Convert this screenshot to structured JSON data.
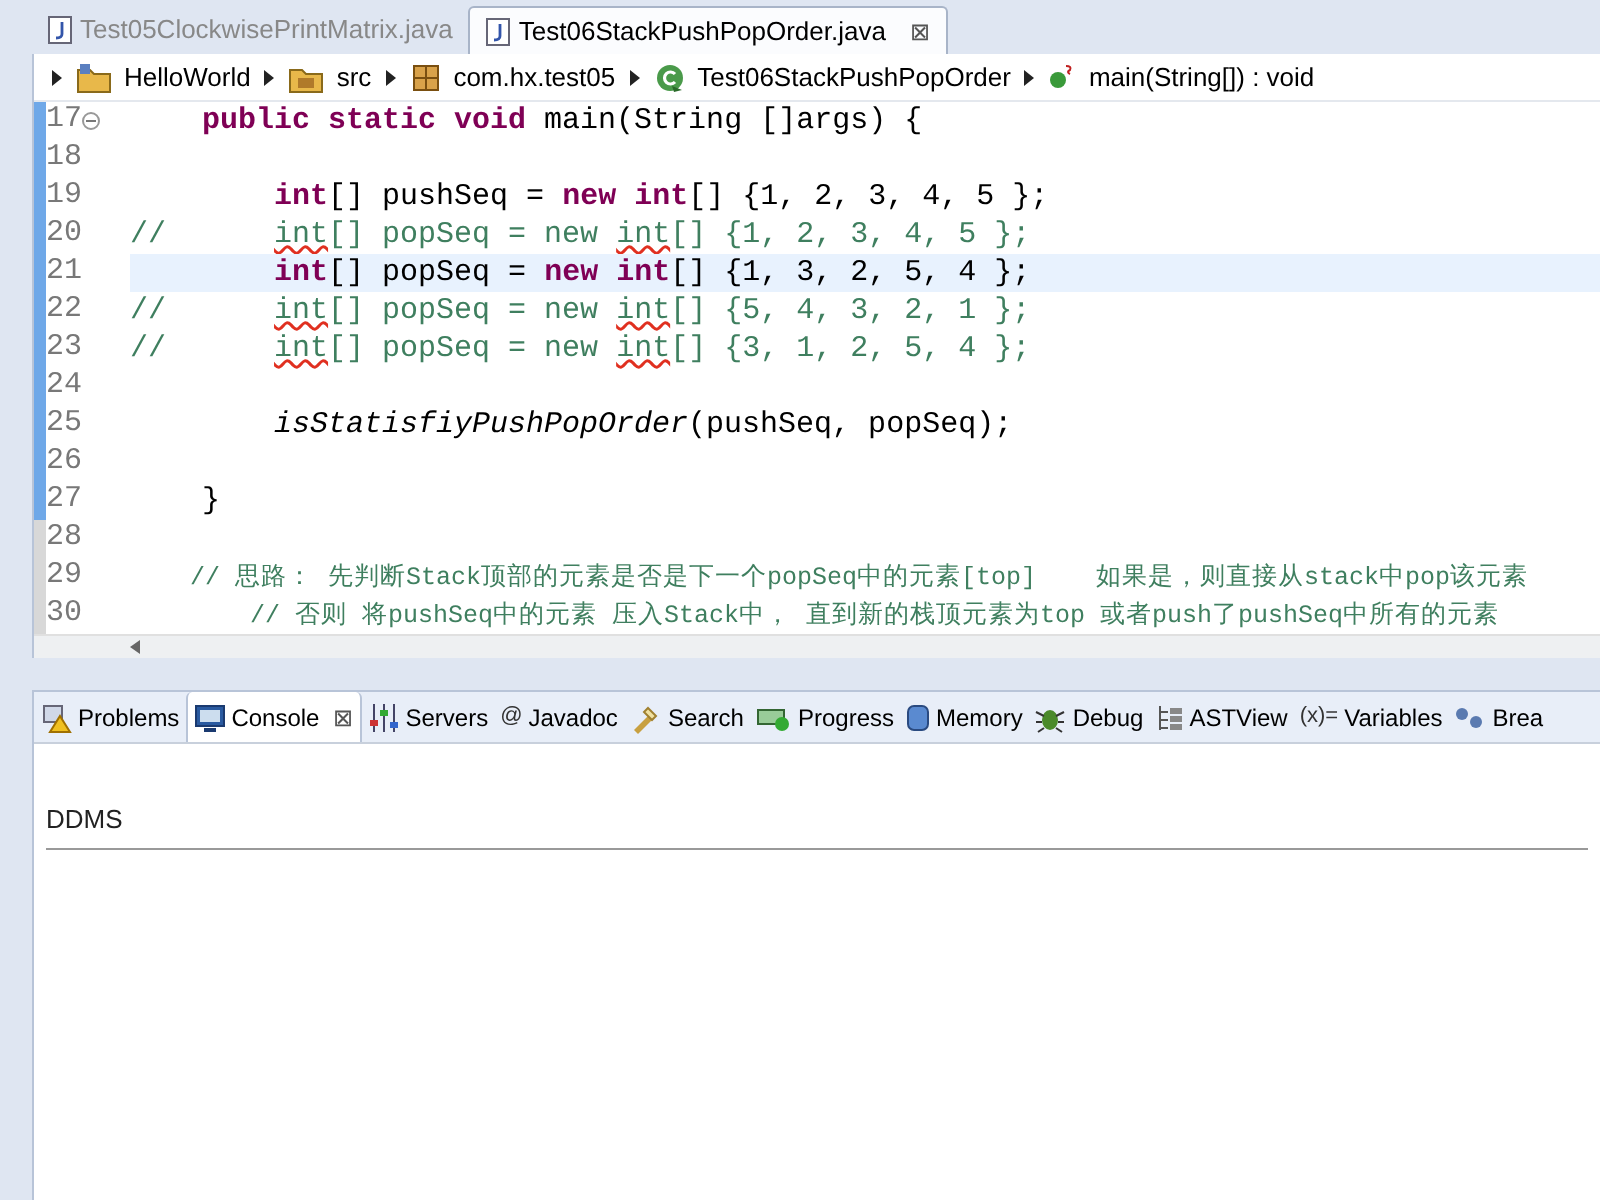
{
  "editor_tabs": [
    {
      "label": "Test05ClockwisePrintMatrix.java",
      "selected": false
    },
    {
      "label": "Test06StackPushPopOrder.java",
      "selected": true,
      "close": "⊠"
    }
  ],
  "breadcrumb": [
    {
      "kind": "project",
      "label": "HelloWorld"
    },
    {
      "kind": "folder",
      "label": "src"
    },
    {
      "kind": "package",
      "label": "com.hx.test05"
    },
    {
      "kind": "class",
      "label": "Test06StackPushPopOrder"
    },
    {
      "kind": "method",
      "label": "main(String[]) : void"
    }
  ],
  "code_lines": [
    {
      "number": "17",
      "marked": true,
      "current": false,
      "fold": true,
      "segments": [
        {
          "kind": "keyword",
          "text": "    public"
        },
        {
          "kind": "keyword",
          "text": " static"
        },
        {
          "kind": "keyword",
          "text": " void"
        },
        {
          "kind": "plain",
          "text": " main(String []args) {"
        }
      ]
    },
    {
      "number": "18",
      "marked": true
    },
    {
      "number": "19",
      "marked": true,
      "current": false,
      "segments": [
        {
          "kind": "keyword",
          "text": "        int"
        },
        {
          "kind": "plain",
          "text": "[] pushSeq = "
        },
        {
          "kind": "keyword",
          "text": "new"
        },
        {
          "kind": "keyword",
          "text": " int"
        },
        {
          "kind": "plain",
          "text": "[] {1, 2, 3, 4, 5 };"
        }
      ]
    },
    {
      "number": "20",
      "marked": true,
      "current": false,
      "segments": [
        {
          "kind": "comment",
          "text": "//      "
        },
        {
          "kind": "comment-error",
          "text": "int"
        },
        {
          "kind": "comment",
          "text": "[] popSeq = new "
        },
        {
          "kind": "comment-error",
          "text": "int"
        },
        {
          "kind": "comment",
          "text": "[] {1, 2, 3, 4, 5 };"
        }
      ]
    },
    {
      "number": "21",
      "marked": true,
      "current": true,
      "segments": [
        {
          "kind": "keyword",
          "text": "        int"
        },
        {
          "kind": "plain",
          "text": "[] popSeq = "
        },
        {
          "kind": "keyword",
          "text": "new"
        },
        {
          "kind": "keyword",
          "text": " int"
        },
        {
          "kind": "plain",
          "text": "[] {1, 3, 2, 5, 4 };"
        }
      ]
    },
    {
      "number": "22",
      "marked": true,
      "current": false,
      "segments": [
        {
          "kind": "comment",
          "text": "//      "
        },
        {
          "kind": "comment-error",
          "text": "int"
        },
        {
          "kind": "comment",
          "text": "[] popSeq = new "
        },
        {
          "kind": "comment-error",
          "text": "int"
        },
        {
          "kind": "comment",
          "text": "[] {5, 4, 3, 2, 1 };"
        }
      ]
    },
    {
      "number": "23",
      "marked": true,
      "current": false,
      "segments": [
        {
          "kind": "comment",
          "text": "//      "
        },
        {
          "kind": "comment-error",
          "text": "int"
        },
        {
          "kind": "comment",
          "text": "[] popSeq = new "
        },
        {
          "kind": "comment-error",
          "text": "int"
        },
        {
          "kind": "comment",
          "text": "[] {3, 1, 2, 5, 4 };"
        }
      ]
    },
    {
      "number": "24",
      "marked": true
    },
    {
      "number": "25",
      "marked": true,
      "current": false,
      "segments": [
        {
          "kind": "method",
          "text": "        isStatisfiyPushPopOrder"
        },
        {
          "kind": "plain",
          "text": "(pushSeq, popSeq);"
        }
      ]
    },
    {
      "number": "26",
      "marked": true
    },
    {
      "number": "27",
      "marked": true,
      "current": false,
      "segments": [
        {
          "kind": "plain",
          "text": "    }"
        }
      ]
    },
    {
      "number": "28",
      "marked": false
    },
    {
      "number": "29",
      "marked": false,
      "current": false,
      "segments": [
        {
          "kind": "comment-cjk",
          "text": "    // 思路： 先判断Stack顶部的元素是否是下一个popSeq中的元素[top]    如果是，则直接从stack中pop该元素"
        }
      ]
    },
    {
      "number": "30",
      "marked": false,
      "current": false,
      "segments": [
        {
          "kind": "comment-cjk",
          "text": "        // 否则 将pushSeq中的元素 压入Stack中， 直到新的栈顶元素为top 或者push了pushSeq中所有的元素"
        }
      ]
    }
  ],
  "view_tabs": [
    {
      "kind": "problems",
      "label": "Problems",
      "selected": false
    },
    {
      "kind": "console",
      "label": "Console",
      "selected": true,
      "close": "⊠"
    },
    {
      "kind": "servers",
      "label": "Servers",
      "selected": false
    },
    {
      "kind": "javadoc",
      "icon_text": "@",
      "label": "Javadoc",
      "selected": false
    },
    {
      "kind": "search",
      "label": "Search",
      "selected": false
    },
    {
      "kind": "progress",
      "label": "Progress",
      "selected": false
    },
    {
      "kind": "memory",
      "label": "Memory",
      "selected": false
    },
    {
      "kind": "debug",
      "label": "Debug",
      "selected": false
    },
    {
      "kind": "astview",
      "label": "ASTView",
      "selected": false
    },
    {
      "kind": "variables",
      "icon_text": "(x)=",
      "label": "Variables",
      "selected": false
    },
    {
      "kind": "breakpoints",
      "label": "Brea",
      "selected": false
    }
  ],
  "console": {
    "title": "DDMS"
  }
}
